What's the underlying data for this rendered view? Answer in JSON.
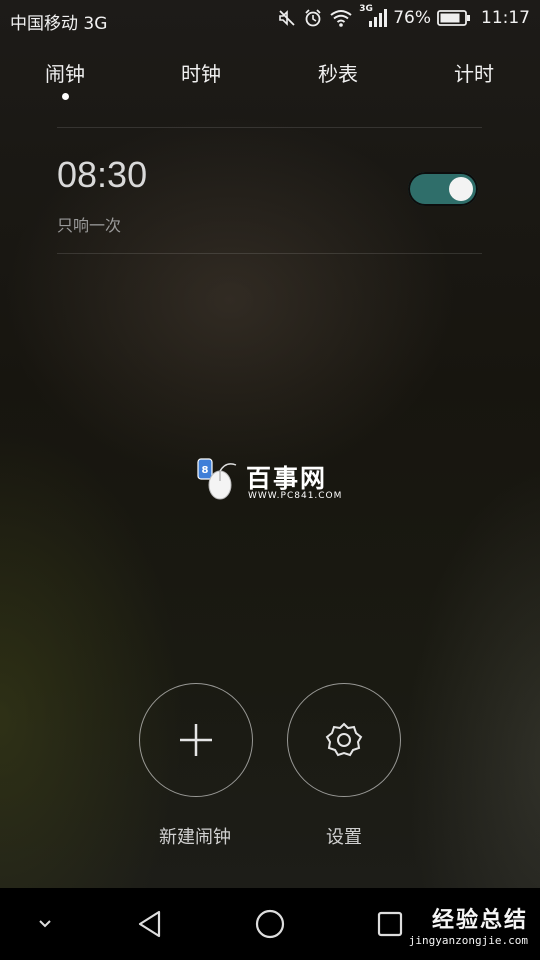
{
  "status_bar": {
    "carrier": "中国移动 3G",
    "network_badge": "3G",
    "battery": "76%",
    "time": "11:17",
    "icons": [
      "muted-icon",
      "alarm-icon",
      "wifi-icon",
      "signal-icon",
      "battery-icon"
    ]
  },
  "tabs": [
    {
      "label": "闹钟",
      "selected": true
    },
    {
      "label": "时钟",
      "selected": false
    },
    {
      "label": "秒表",
      "selected": false
    },
    {
      "label": "计时",
      "selected": false
    }
  ],
  "alarms": [
    {
      "time": "08:30",
      "repeat": "只响一次",
      "enabled": true
    }
  ],
  "watermark": {
    "text": "百事网",
    "url": "WWW.PC841.COM"
  },
  "actions": {
    "new_alarm_label": "新建闹钟",
    "settings_label": "设置"
  },
  "navbar": {
    "buttons": [
      "chevron-down-icon",
      "back-icon",
      "home-icon",
      "recents-icon"
    ],
    "brand_main": "经验总结",
    "brand_sub": "jingyanzongjie.com"
  },
  "colors": {
    "toggle_on": "#2f6e6a",
    "background": "#1a1814"
  }
}
